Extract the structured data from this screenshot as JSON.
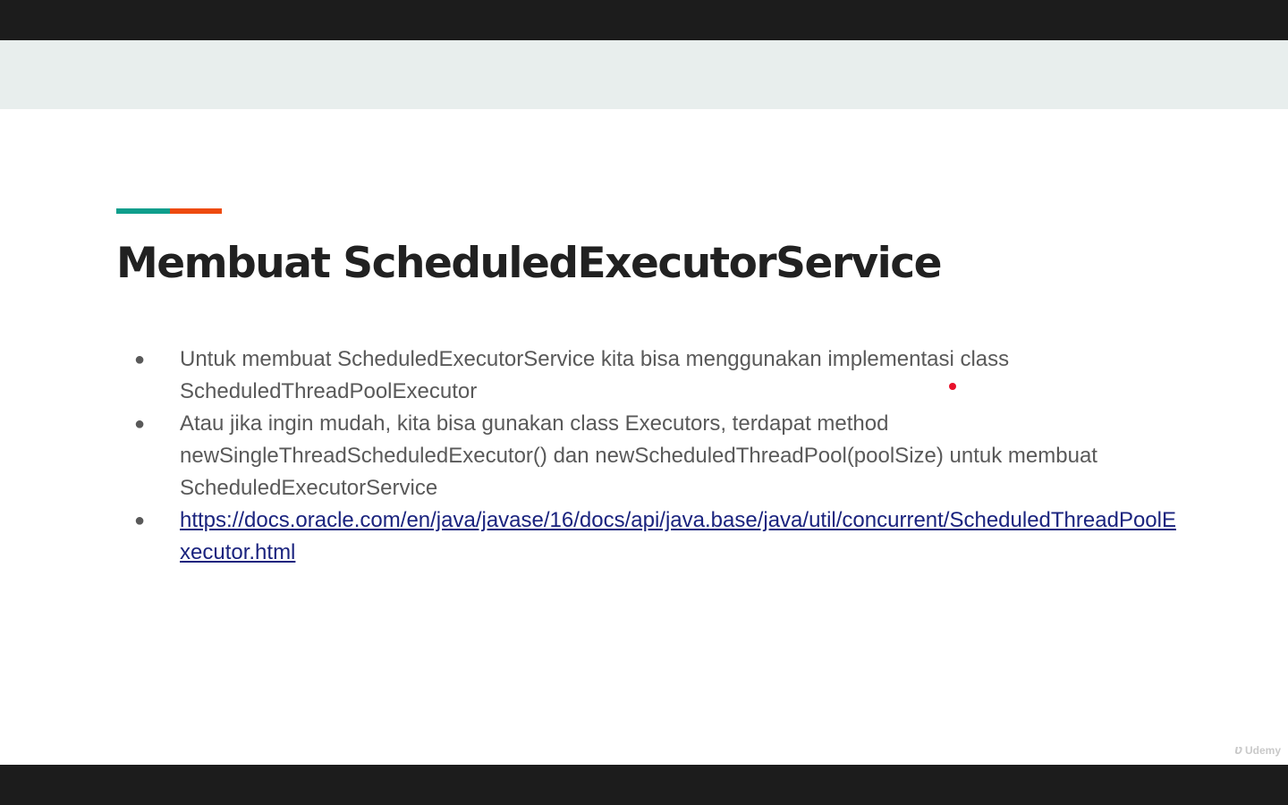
{
  "colors": {
    "accent_teal": "#0e9e8c",
    "accent_orange": "#ee4b0e",
    "title": "#212121",
    "body_text": "#595959",
    "link": "#1a237e",
    "pointer": "#e8102a"
  },
  "slide": {
    "title": "Membuat ScheduledExecutorService",
    "bullets": [
      {
        "marker": "●",
        "text": "Untuk membuat ScheduledExecutorService kita bisa menggunakan implementasi class ScheduledThreadPoolExecutor"
      },
      {
        "marker": "●",
        "text": "Atau jika ingin mudah, kita bisa gunakan class Executors, terdapat method newSingleThreadScheduledExecutor() dan newScheduledThreadPool(poolSize) untuk membuat ScheduledExecutorService"
      },
      {
        "marker": "●",
        "link": "https://docs.oracle.com/en/java/javase/16/docs/api/java.base/java/util/concurrent/ScheduledThreadPoolExecutor.html"
      }
    ]
  },
  "watermark": {
    "icon": "udemy-logo-icon",
    "text": "Udemy"
  }
}
